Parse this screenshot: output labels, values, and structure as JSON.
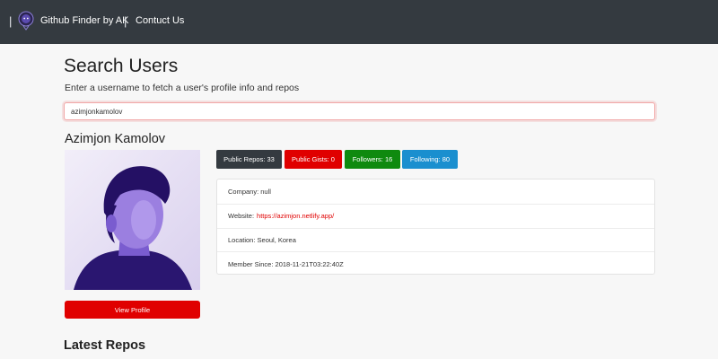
{
  "navbar": {
    "brand": "Github Finder by AK",
    "separator": "|",
    "links": [
      {
        "label": "Contuct Us"
      }
    ]
  },
  "search": {
    "title": "Search Users",
    "subtitle": "Enter a username to fetch a user's profile info and repos",
    "input_value": "azimjonkamolov"
  },
  "profile": {
    "name": "Azimjon Kamolov",
    "view_profile_label": "View Profile",
    "badges": [
      {
        "label": "Public Repos: 33",
        "color": "#343a40"
      },
      {
        "label": "Public Gists: 0",
        "color": "#e00000"
      },
      {
        "label": "Followers: 16",
        "color": "#0f8a0f"
      },
      {
        "label": "Following: 80",
        "color": "#1a8fcf"
      }
    ],
    "info": {
      "company": "Company: null",
      "website_label": "Website:",
      "website_url": "https://azimjon.netlify.app/",
      "location": "Location: Seoul, Korea",
      "member_since": "Member Since: 2018-11-21T03:22:40Z"
    }
  },
  "repos": {
    "title": "Latest Repos"
  },
  "icons": {
    "brand_logo": "github-octocat-logo-icon"
  }
}
